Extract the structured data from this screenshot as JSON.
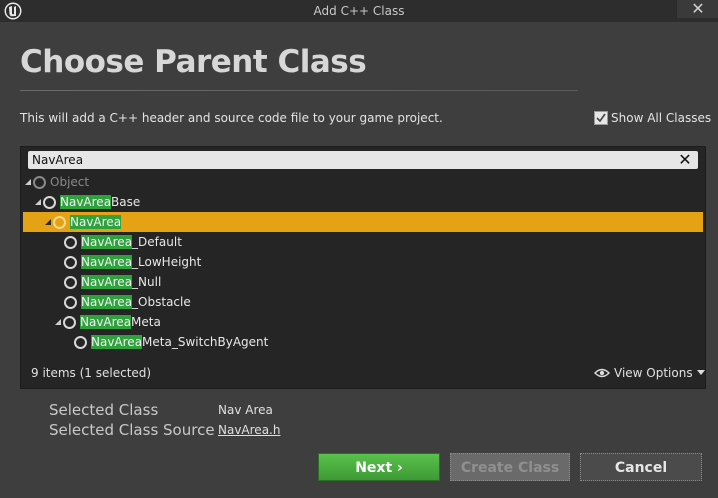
{
  "window": {
    "title": "Add C++ Class",
    "close_glyph": "✕"
  },
  "heading": "Choose Parent Class",
  "description": "This will add a C++ header and source code file to your game project.",
  "show_all": {
    "label": "Show All Classes",
    "checked": true
  },
  "search": {
    "value": "NavArea",
    "placeholder": ""
  },
  "tree": [
    {
      "id": "object",
      "prefix": "",
      "rest": "Object",
      "dim": true
    },
    {
      "id": "navareabase",
      "prefix": "NavArea",
      "rest": "Base"
    },
    {
      "id": "navarea",
      "prefix": "NavArea",
      "rest": "",
      "selected": true
    },
    {
      "id": "navarea-default",
      "prefix": "NavArea",
      "rest": "_Default"
    },
    {
      "id": "navarea-lowheight",
      "prefix": "NavArea",
      "rest": "_LowHeight"
    },
    {
      "id": "navarea-null",
      "prefix": "NavArea",
      "rest": "_Null"
    },
    {
      "id": "navarea-obstacle",
      "prefix": "NavArea",
      "rest": "_Obstacle"
    },
    {
      "id": "navareameta",
      "prefix": "NavArea",
      "rest": "Meta"
    },
    {
      "id": "navareameta-switch",
      "prefix": "NavArea",
      "rest": "Meta_SwitchByAgent"
    }
  ],
  "items_count": "9 items (1 selected)",
  "view_options": "View Options",
  "selected_class": {
    "label": "Selected Class",
    "value": "Nav Area"
  },
  "selected_source": {
    "label": "Selected Class Source",
    "value": "NavArea.h"
  },
  "buttons": {
    "next": "Next",
    "next_chevron": "›",
    "create": "Create Class",
    "cancel": "Cancel"
  },
  "colors": {
    "highlight": "#2ea33d",
    "selection": "#e4a214",
    "accent_next": "#4caf41"
  }
}
